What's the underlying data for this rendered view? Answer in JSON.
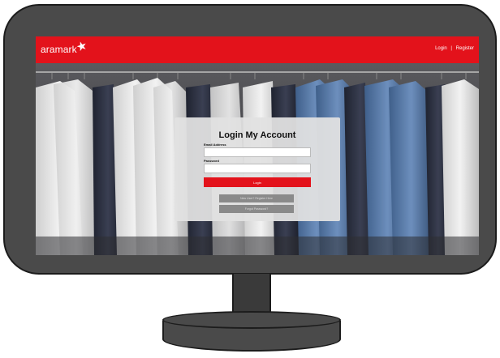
{
  "header": {
    "logo_text": "aramark",
    "logo_star": "★",
    "nav": {
      "login": "Login",
      "separator": "|",
      "register": "Register"
    }
  },
  "login": {
    "title": "Login My Account",
    "email_label": "Email Address",
    "email_value": "",
    "password_label": "Password",
    "password_value": "",
    "submit_label": "Login",
    "new_user_label": "New User? Register Here",
    "forgot_label": "Forgot Password?"
  },
  "colors": {
    "brand_red": "#e3121b",
    "monitor": "#4a4a4a",
    "panel": "#e1e1e1",
    "secondary_button": "#8a8a8a"
  },
  "icons": [
    "aramark-star-logo-icon"
  ]
}
